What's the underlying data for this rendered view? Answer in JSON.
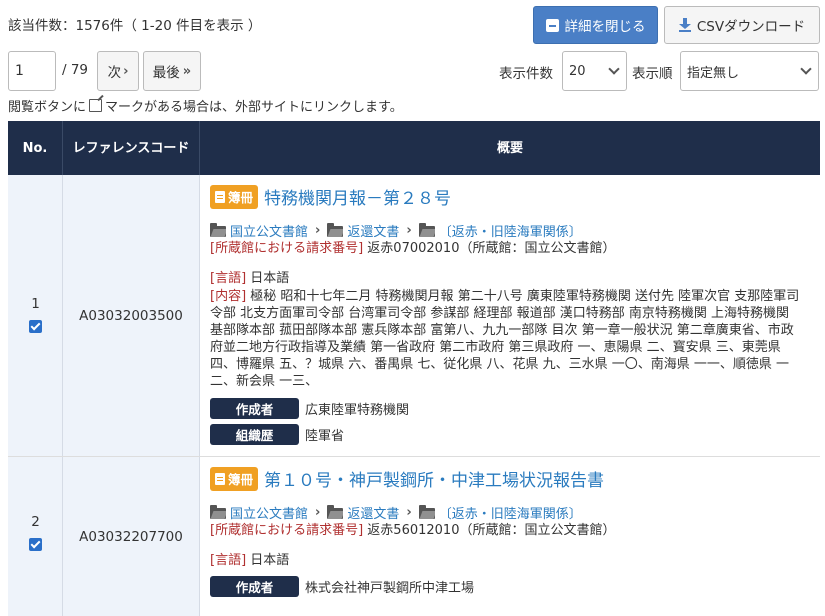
{
  "summary": {
    "result_count": "該当件数：1576件（ 1-20 件目を表示 ）"
  },
  "toolbar": {
    "close_detail_label": "詳細を閉じる",
    "csv_download_label": "CSVダウンロード"
  },
  "pager": {
    "current_page": "1",
    "total_pages": "/ 79",
    "next_label": "次",
    "last_label": "最後",
    "per_page_label": "表示件数",
    "per_page_value": "20",
    "sort_label": "表示順",
    "sort_value": "指定無し"
  },
  "notice": {
    "before_icon": "閲覧ボタンに",
    "after_icon": "マークがある場合は、外部サイトにリンクします。"
  },
  "table": {
    "headers": {
      "no": "No.",
      "ref": "レファレンスコード",
      "summary": "概要"
    },
    "rows": [
      {
        "no": "1",
        "ref": "A03032003500",
        "badge": "簿冊",
        "title": "特務機関月報－第２８号",
        "path": [
          "国立公文書館",
          "返還文書",
          "〔返赤・旧陸海軍関係〕"
        ],
        "call_label": "[所蔵館における請求番号]",
        "call_value": "返赤07002010（所蔵館：国立公文書館）",
        "lang_label": "[言語]",
        "lang_value": "日本語",
        "content_label": "[内容]",
        "content_value": "極秘 昭和十七年二月 特務機関月報 第二十八号 廣東陸軍特務機関 送付先 陸軍次官 支那陸軍司令部 北支方面軍司令部 台湾軍司令部 参謀部 経理部 報道部 漢口特務部 南京特務機関 上海特務機関 基部隊本部 菰田部隊本部 憲兵隊本部 富第八、九九一部隊 目次 第一章一般状況 第二章廣東省、市政府並二地方行政指導及業績 第一省政府 第二市政府 第三県政府 一、恵陽県 二、寳安県 三、東莞県 四、博羅県 五、？城県 六、番禺県 七、従化県 八、花県 九、三水県 一〇、南海県 一一、順徳県 一二、新会県 一三、",
        "tags": [
          {
            "label": "作成者",
            "value": "広東陸軍特務機関"
          },
          {
            "label": "組織歴",
            "value": "陸軍省"
          }
        ]
      },
      {
        "no": "2",
        "ref": "A03032207700",
        "badge": "簿冊",
        "title": "第１０号・神戸製鋼所・中津工場状況報告書",
        "path": [
          "国立公文書館",
          "返還文書",
          "〔返赤・旧陸海軍関係〕"
        ],
        "call_label": "[所蔵館における請求番号]",
        "call_value": "返赤56012010（所蔵館：国立公文書館）",
        "lang_label": "[言語]",
        "lang_value": "日本語",
        "tags": [
          {
            "label": "作成者",
            "value": "株式会社神戸製鋼所中津工場"
          }
        ]
      }
    ]
  }
}
